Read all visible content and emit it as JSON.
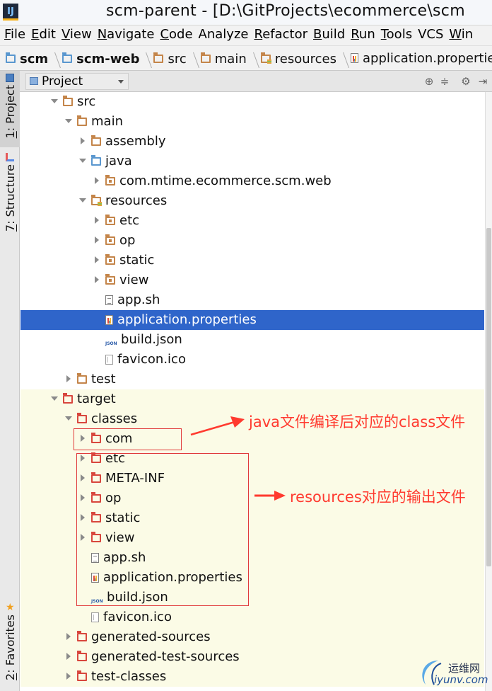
{
  "window": {
    "app_icon_text": "IJ",
    "title": "scm-parent - [D:\\GitProjects\\ecommerce\\scm"
  },
  "menu": [
    {
      "mn": "F",
      "rest": "ile"
    },
    {
      "mn": "E",
      "rest": "dit"
    },
    {
      "mn": "V",
      "rest": "iew"
    },
    {
      "mn": "N",
      "rest": "avigate"
    },
    {
      "mn": "C",
      "rest": "ode"
    },
    {
      "mn": "",
      "rest": "Analyze"
    },
    {
      "mn": "R",
      "rest": "efactor"
    },
    {
      "mn": "B",
      "rest": "uild"
    },
    {
      "mn": "R",
      "rest": "un"
    },
    {
      "mn": "T",
      "rest": "ools"
    },
    {
      "mn": "",
      "rest": "VCS"
    },
    {
      "mn": "W",
      "rest": "in"
    }
  ],
  "breadcrumbs": [
    {
      "label": "scm",
      "bold": true,
      "icon": "module-folder-icon"
    },
    {
      "label": "scm-web",
      "bold": true,
      "icon": "module-folder-icon"
    },
    {
      "label": "src",
      "bold": false,
      "icon": "folder-icon"
    },
    {
      "label": "main",
      "bold": false,
      "icon": "folder-icon"
    },
    {
      "label": "resources",
      "bold": false,
      "icon": "resources-folder-icon"
    },
    {
      "label": "application.properties",
      "bold": false,
      "icon": "properties-file-icon"
    }
  ],
  "left_tabs": {
    "project": {
      "num": "1",
      "label": ": Project"
    },
    "structure": {
      "num": "7",
      "label": ": Structure"
    },
    "favorites": {
      "num": "2",
      "label": ": Favorites"
    }
  },
  "project_panel": {
    "view_selector": "Project",
    "icons": [
      "target-icon",
      "collapse-icon",
      "gear-icon",
      "hide-icon"
    ]
  },
  "tree": [
    {
      "label": "src",
      "arrow": "down",
      "icon": "folder",
      "level": 0
    },
    {
      "label": "main",
      "arrow": "down",
      "icon": "folder",
      "level": 1
    },
    {
      "label": "assembly",
      "arrow": "right",
      "icon": "folder",
      "level": 2
    },
    {
      "label": "java",
      "arrow": "down",
      "icon": "folder-blue",
      "level": 2
    },
    {
      "label": "com.mtime.ecommerce.scm.web",
      "arrow": "right",
      "icon": "package",
      "level": 3
    },
    {
      "label": "resources",
      "arrow": "down",
      "icon": "folder-res",
      "level": 2
    },
    {
      "label": "etc",
      "arrow": "right",
      "icon": "package",
      "level": 3
    },
    {
      "label": "op",
      "arrow": "right",
      "icon": "package",
      "level": 3
    },
    {
      "label": "static",
      "arrow": "right",
      "icon": "package",
      "level": 3
    },
    {
      "label": "view",
      "arrow": "right",
      "icon": "package",
      "level": 3
    },
    {
      "label": "app.sh",
      "arrow": "none",
      "icon": "file-text",
      "level": 3
    },
    {
      "label": "application.properties",
      "arrow": "none",
      "icon": "file-props",
      "level": 3,
      "selected": true
    },
    {
      "label": "build.json",
      "arrow": "none",
      "icon": "file-json",
      "level": 3
    },
    {
      "label": "favicon.ico",
      "arrow": "none",
      "icon": "file-ico",
      "level": 3
    },
    {
      "label": "test",
      "arrow": "right",
      "icon": "folder",
      "level": 1
    },
    {
      "label": "target",
      "arrow": "down",
      "icon": "folder-red",
      "level": 0,
      "excluded": true
    },
    {
      "label": "classes",
      "arrow": "down",
      "icon": "folder-red",
      "level": 1,
      "excluded": true
    },
    {
      "label": "com",
      "arrow": "right",
      "icon": "folder-red",
      "level": 2,
      "excluded": true
    },
    {
      "label": "etc",
      "arrow": "right",
      "icon": "folder-red",
      "level": 2,
      "excluded": true
    },
    {
      "label": "META-INF",
      "arrow": "right",
      "icon": "folder-red",
      "level": 2,
      "excluded": true
    },
    {
      "label": "op",
      "arrow": "right",
      "icon": "folder-red",
      "level": 2,
      "excluded": true
    },
    {
      "label": "static",
      "arrow": "right",
      "icon": "folder-red",
      "level": 2,
      "excluded": true
    },
    {
      "label": "view",
      "arrow": "right",
      "icon": "folder-red",
      "level": 2,
      "excluded": true
    },
    {
      "label": "app.sh",
      "arrow": "none",
      "icon": "file-text",
      "level": 2,
      "excluded": true
    },
    {
      "label": "application.properties",
      "arrow": "none",
      "icon": "file-props",
      "level": 2,
      "excluded": true
    },
    {
      "label": "build.json",
      "arrow": "none",
      "icon": "file-json",
      "level": 2,
      "excluded": true
    },
    {
      "label": "favicon.ico",
      "arrow": "none",
      "icon": "file-ico",
      "level": 2,
      "excluded": true
    },
    {
      "label": "generated-sources",
      "arrow": "right",
      "icon": "folder-red",
      "level": 1,
      "excluded": true
    },
    {
      "label": "generated-test-sources",
      "arrow": "right",
      "icon": "folder-red",
      "level": 1,
      "excluded": true
    },
    {
      "label": "test-classes",
      "arrow": "right",
      "icon": "folder-red",
      "level": 1,
      "excluded": true
    }
  ],
  "annotations": {
    "class_note": "java文件编译后对应的class文件",
    "resources_note": "resources对应的输出文件",
    "color": "#ff3a2f"
  },
  "watermark": {
    "cn": "运维网",
    "url": "iyunv.com"
  },
  "colors": {
    "selection": "#2f65ca",
    "excluded_bg": "#fbfbe6",
    "folder": "#c4854a",
    "excluded_folder": "#d8473d",
    "source_folder": "#5a97cf"
  }
}
